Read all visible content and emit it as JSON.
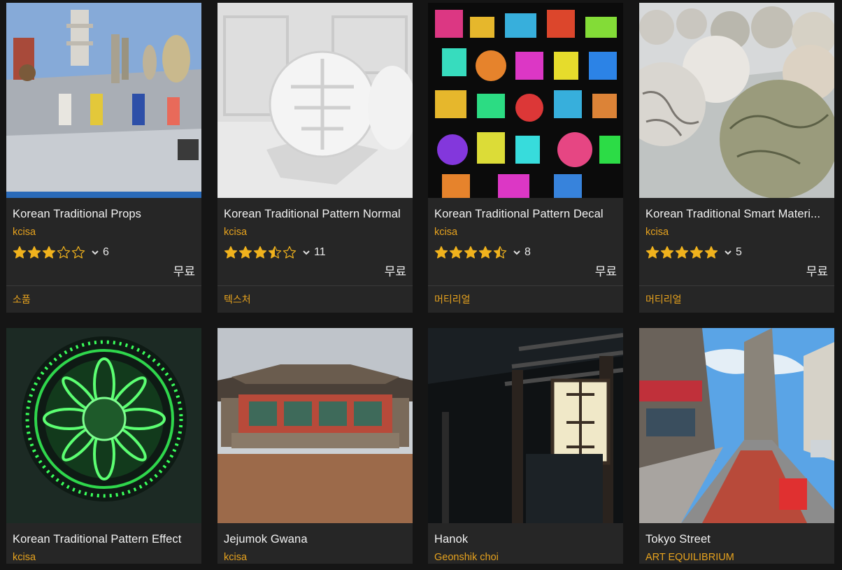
{
  "colors": {
    "accent": "#e6a21e",
    "card_bg": "#262626",
    "page_bg": "#151515",
    "star": "#f0b21d"
  },
  "cards": [
    {
      "title": "Korean Traditional Props",
      "seller": "kcisa",
      "rating": 3,
      "rating_count": "6",
      "price": "무료",
      "category": "소품"
    },
    {
      "title": "Korean Traditional Pattern Normal",
      "seller": "kcisa",
      "rating": 3.5,
      "rating_count": "11",
      "price": "무료",
      "category": "텍스처"
    },
    {
      "title": "Korean Traditional Pattern Decal",
      "seller": "kcisa",
      "rating": 4.5,
      "rating_count": "8",
      "price": "무료",
      "category": "머티리얼"
    },
    {
      "title": "Korean Traditional Smart Materi...",
      "seller": "kcisa",
      "rating": 5,
      "rating_count": "5",
      "price": "무료",
      "category": "머티리얼"
    },
    {
      "title": "Korean Traditional Pattern Effect",
      "seller": "kcisa"
    },
    {
      "title": "Jejumok Gwana",
      "seller": "kcisa"
    },
    {
      "title": "Hanok",
      "seller": "Geonshik choi"
    },
    {
      "title": "Tokyo Street",
      "seller": "ART EQUILIBRIUM"
    }
  ]
}
